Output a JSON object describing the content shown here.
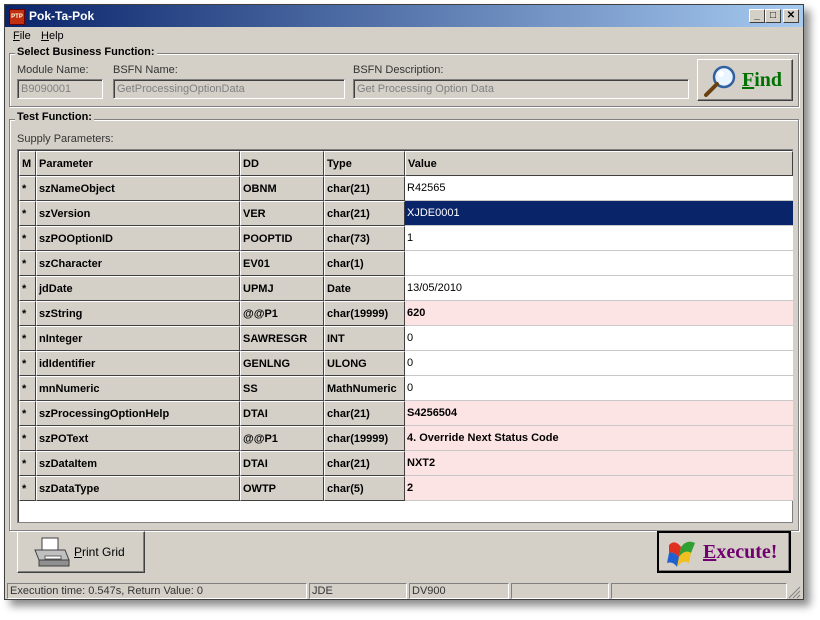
{
  "window": {
    "title": "Pok-Ta-Pok",
    "app_icon_label": "PTP"
  },
  "menu": [
    {
      "label": "File",
      "accel": "F",
      "rest": "ile"
    },
    {
      "label": "Help",
      "accel": "H",
      "rest": "elp"
    }
  ],
  "business_function": {
    "group_label": "Select Business Function:",
    "module_label": "Module Name:",
    "module_value": "B9090001",
    "bsfn_label": "BSFN Name:",
    "bsfn_value": "GetProcessingOptionData",
    "desc_label": "BSFN Description:",
    "desc_value": "Get Processing Option Data",
    "find_label": "Find",
    "find_accel": "F",
    "find_rest": "ind"
  },
  "test_function": {
    "group_label": "Test Function:",
    "supply_label": "Supply Parameters:"
  },
  "grid": {
    "headers": [
      "M",
      "Parameter",
      "DD",
      "Type",
      "Value"
    ],
    "rows": [
      {
        "m": "*",
        "parameter": "szNameObject",
        "dd": "OBNM",
        "type": "char(21)",
        "value": "R42565",
        "style": "normal"
      },
      {
        "m": "*",
        "parameter": "szVersion",
        "dd": "VER",
        "type": "char(21)",
        "value": "XJDE0001",
        "style": "selected"
      },
      {
        "m": "*",
        "parameter": "szPOOptionID",
        "dd": "POOPTID",
        "type": "char(73)",
        "value": "1",
        "style": "normal"
      },
      {
        "m": "*",
        "parameter": "szCharacter",
        "dd": "EV01",
        "type": "char(1)",
        "value": "",
        "style": "normal"
      },
      {
        "m": "*",
        "parameter": "jdDate",
        "dd": "UPMJ",
        "type": "Date",
        "value": "13/05/2010",
        "style": "normal"
      },
      {
        "m": "*",
        "parameter": "szString",
        "dd": "@@P1",
        "type": "char(19999)",
        "value": "620",
        "style": "highlight"
      },
      {
        "m": "*",
        "parameter": "nInteger",
        "dd": "SAWRESGR",
        "type": "INT",
        "value": "0",
        "style": "normal"
      },
      {
        "m": "*",
        "parameter": "idIdentifier",
        "dd": "GENLNG",
        "type": "ULONG",
        "value": "0",
        "style": "normal"
      },
      {
        "m": "*",
        "parameter": "mnNumeric",
        "dd": "SS",
        "type": "MathNumeric",
        "value": "0",
        "style": "normal"
      },
      {
        "m": "*",
        "parameter": "szProcessingOptionHelp",
        "dd": "DTAI",
        "type": "char(21)",
        "value": "S4256504",
        "style": "highlight"
      },
      {
        "m": "*",
        "parameter": "szPOText",
        "dd": "@@P1",
        "type": "char(19999)",
        "value": "4.  Override Next Status Code",
        "style": "highlight"
      },
      {
        "m": "*",
        "parameter": "szDataItem",
        "dd": "DTAI",
        "type": "char(21)",
        "value": "NXT2",
        "style": "highlight"
      },
      {
        "m": "*",
        "parameter": "szDataType",
        "dd": "OWTP",
        "type": "char(5)",
        "value": "2",
        "style": "highlight"
      }
    ]
  },
  "buttons": {
    "print_label": "Print Grid",
    "print_accel": "P",
    "print_rest": "rint Grid",
    "execute_label": "Execute!",
    "execute_accel": "E",
    "execute_rest": "xecute!"
  },
  "status": {
    "execution": "Execution time: 0.547s, Return Value: 0",
    "env1": "JDE",
    "env2": "DV900",
    "panel4": "",
    "panel5": ""
  },
  "colors": {
    "selected_row": "#0a246a",
    "highlight_row": "#fde4e4",
    "find_text": "#007000",
    "execute_text": "#700070"
  }
}
